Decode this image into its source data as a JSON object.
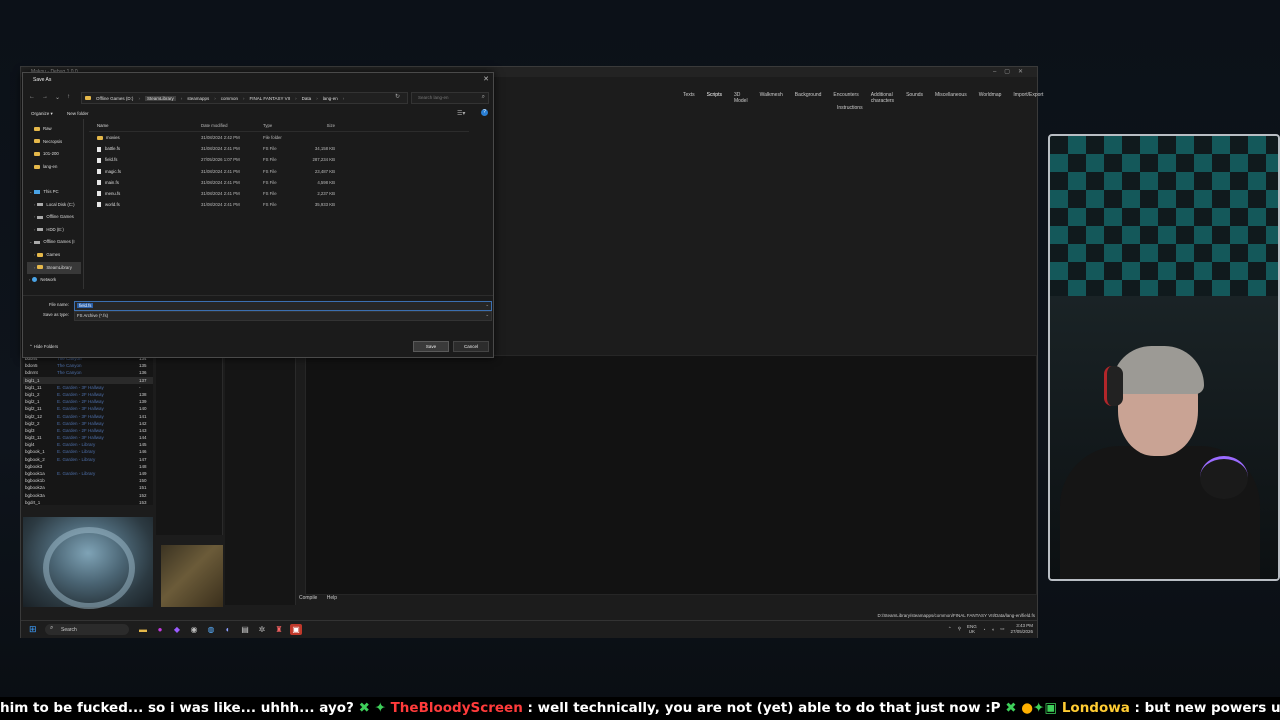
{
  "app": {
    "title": "Makou - Debug 1.0.0",
    "tabs": [
      "Texts",
      "Scripts",
      "3D Model",
      "Walkmesh",
      "Background",
      "Encounters",
      "Additional characters",
      "Sounds",
      "Miscellaneous",
      "Worldmap",
      "Import/Export"
    ],
    "active_tab": "Scripts",
    "instructions_label": "Instructions",
    "compile_label": "Compile",
    "help_label": "Help",
    "status_path": "D:/SteamLibrary/steamapps/common/FINAL FANTASY VII/Data/lang-en/field.fs",
    "field_list": [
      {
        "id": "bdon4",
        "name": "The Canyon",
        "n": "134"
      },
      {
        "id": "bdon5",
        "name": "The Canyon",
        "n": "135"
      },
      {
        "id": "bdnrnt",
        "name": "The Canyon",
        "n": "136"
      },
      {
        "id": "bigl1_1",
        "name": "",
        "n": "137"
      },
      {
        "id": "bigl1_11",
        "name": "E. Garden - 3F Hallway",
        "n": "-"
      },
      {
        "id": "bigl1_2",
        "name": "E. Garden - 2F Hallway",
        "n": "138"
      },
      {
        "id": "bigl2_1",
        "name": "E. Garden - 2F Hallway",
        "n": "139"
      },
      {
        "id": "bigl2_11",
        "name": "E. Garden - 3F Hallway",
        "n": "140"
      },
      {
        "id": "bigl2_12",
        "name": "E. Garden - 3F Hallway",
        "n": "141"
      },
      {
        "id": "bigl2_2",
        "name": "E. Garden - 3F Hallway",
        "n": "142"
      },
      {
        "id": "bigl3",
        "name": "E. Garden - 2F Hallway",
        "n": "143"
      },
      {
        "id": "bigl3_11",
        "name": "E. Garden - 3F Hallway",
        "n": "144"
      },
      {
        "id": "bigl4",
        "name": "E. Garden - Library",
        "n": "145"
      },
      {
        "id": "bgbook_1",
        "name": "E. Garden - Library",
        "n": "146"
      },
      {
        "id": "bgbook_2",
        "name": "E. Garden - Library",
        "n": "147"
      },
      {
        "id": "bgbook3",
        "name": "",
        "n": "148"
      },
      {
        "id": "bgbook1a",
        "name": "E. Garden - Library",
        "n": "149"
      },
      {
        "id": "bgbook1b",
        "name": "",
        "n": "150"
      },
      {
        "id": "bgbook2a",
        "name": "",
        "n": "151"
      },
      {
        "id": "bgbook3a",
        "name": "",
        "n": "152"
      },
      {
        "id": "bgdrt_1",
        "name": "",
        "n": "153"
      }
    ]
  },
  "dialog": {
    "title": "Save As",
    "breadcrumb": [
      "Offline Games (D:)",
      "SteamLibrary",
      "steamapps",
      "common",
      "FINAL FANTASY VII",
      "Data",
      "lang-en"
    ],
    "selected_crumb": "SteamLibrary",
    "search_placeholder": "Search lang-en",
    "organize_label": "Organize ▾",
    "new_folder_label": "New folder",
    "nav": [
      {
        "label": "Raw",
        "kind": "folder",
        "indent": 1
      },
      {
        "label": "Necropsis",
        "kind": "folder",
        "indent": 1
      },
      {
        "label": "101-200",
        "kind": "folder",
        "indent": 1
      },
      {
        "label": "lang-en",
        "kind": "folder",
        "indent": 1
      },
      {
        "label": "",
        "kind": "blank",
        "indent": 0
      },
      {
        "label": "This PC",
        "kind": "pc",
        "indent": 0
      },
      {
        "label": "Local Disk (C:)",
        "kind": "drive",
        "indent": 1
      },
      {
        "label": "Offline Games",
        "kind": "drive",
        "indent": 1
      },
      {
        "label": "HDD (E:)",
        "kind": "drive",
        "indent": 1
      },
      {
        "label": "Offline Games (I",
        "kind": "drive",
        "indent": 0
      },
      {
        "label": "Games",
        "kind": "folder",
        "indent": 1
      },
      {
        "label": "SteamLibrary",
        "kind": "folder",
        "indent": 1
      },
      {
        "label": "Network",
        "kind": "net",
        "indent": 0
      }
    ],
    "selected_nav": "SteamLibrary",
    "columns": {
      "name": "Name",
      "date": "Date modified",
      "type": "Type",
      "size": "Size"
    },
    "files": [
      {
        "name": "movies",
        "date": "31/08/2024 2:42 PM",
        "type": "File folder",
        "size": "",
        "folder": true
      },
      {
        "name": "battle.fs",
        "date": "31/08/2024 2:41 PM",
        "type": "FS File",
        "size": "34,158 KB",
        "folder": false
      },
      {
        "name": "field.fs",
        "date": "27/05/2026 1:07 PM",
        "type": "FS File",
        "size": "287,234 KB",
        "folder": false
      },
      {
        "name": "magic.fs",
        "date": "31/08/2024 2:41 PM",
        "type": "FS File",
        "size": "23,487 KB",
        "folder": false
      },
      {
        "name": "main.fs",
        "date": "31/08/2024 2:41 PM",
        "type": "FS File",
        "size": "4,598 KB",
        "folder": false
      },
      {
        "name": "menu.fs",
        "date": "31/08/2024 2:41 PM",
        "type": "FS File",
        "size": "2,237 KB",
        "folder": false
      },
      {
        "name": "world.fs",
        "date": "31/08/2024 2:41 PM",
        "type": "FS File",
        "size": "35,933 KB",
        "folder": false
      }
    ],
    "file_name_label": "File name:",
    "file_name_value": "field.fs",
    "save_type_label": "Save as type:",
    "save_type_value": "FS Archive (*.fs)",
    "hide_folders_label": "Hide Folders",
    "save_label": "Save",
    "cancel_label": "Cancel"
  },
  "taskbar": {
    "search_label": "Search",
    "lang": "ENG",
    "region": "UK",
    "time": "3:43 PM",
    "date": "27/05/2026"
  },
  "ticker": {
    "lead": "him to be fucked... so i was like... uhhh... ayo?",
    "user1": "TheBloodyScreen",
    "msg1": ": well technically, you are not (yet) able to do that just now :P",
    "user2": "Londowa",
    "msg2": ": but new powers unlocked let's goooo"
  }
}
